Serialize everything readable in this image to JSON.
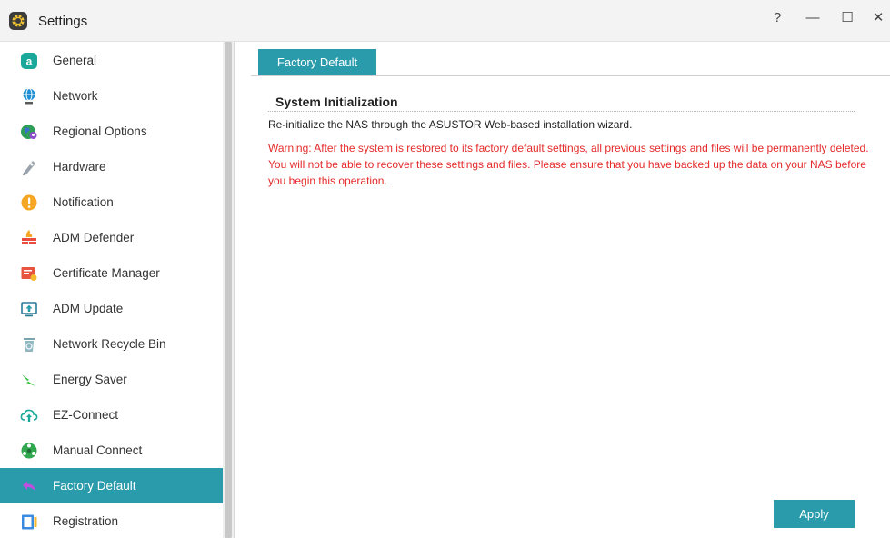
{
  "window": {
    "title": "Settings",
    "help_glyph": "?",
    "minimize_glyph": "—",
    "maximize_glyph": "☐",
    "close_glyph": "✕"
  },
  "sidebar": {
    "items": [
      {
        "label": "General",
        "icon": "general-icon"
      },
      {
        "label": "Network",
        "icon": "network-icon"
      },
      {
        "label": "Regional Options",
        "icon": "regional-options-icon"
      },
      {
        "label": "Hardware",
        "icon": "hardware-icon"
      },
      {
        "label": "Notification",
        "icon": "notification-icon"
      },
      {
        "label": "ADM Defender",
        "icon": "adm-defender-icon"
      },
      {
        "label": "Certificate Manager",
        "icon": "certificate-manager-icon"
      },
      {
        "label": "ADM Update",
        "icon": "adm-update-icon"
      },
      {
        "label": "Network Recycle Bin",
        "icon": "network-recycle-bin-icon"
      },
      {
        "label": "Energy Saver",
        "icon": "energy-saver-icon"
      },
      {
        "label": "EZ-Connect",
        "icon": "ez-connect-icon"
      },
      {
        "label": "Manual Connect",
        "icon": "manual-connect-icon"
      },
      {
        "label": "Factory Default",
        "icon": "factory-default-icon",
        "active": true
      },
      {
        "label": "Registration",
        "icon": "registration-icon"
      }
    ]
  },
  "main": {
    "tab_label": "Factory Default",
    "section_title": "System Initialization",
    "description": "Re-initialize the NAS through the ASUSTOR Web-based installation wizard.",
    "warning": "Warning: After the system is restored to its factory default settings, all previous settings and files will be permanently deleted. You will not be able to recover these settings and files. Please ensure that you have backed up the data on your NAS before you begin this operation.",
    "apply_label": "Apply"
  },
  "colors": {
    "accent": "#2a9bab",
    "warning": "#e52a2a"
  }
}
